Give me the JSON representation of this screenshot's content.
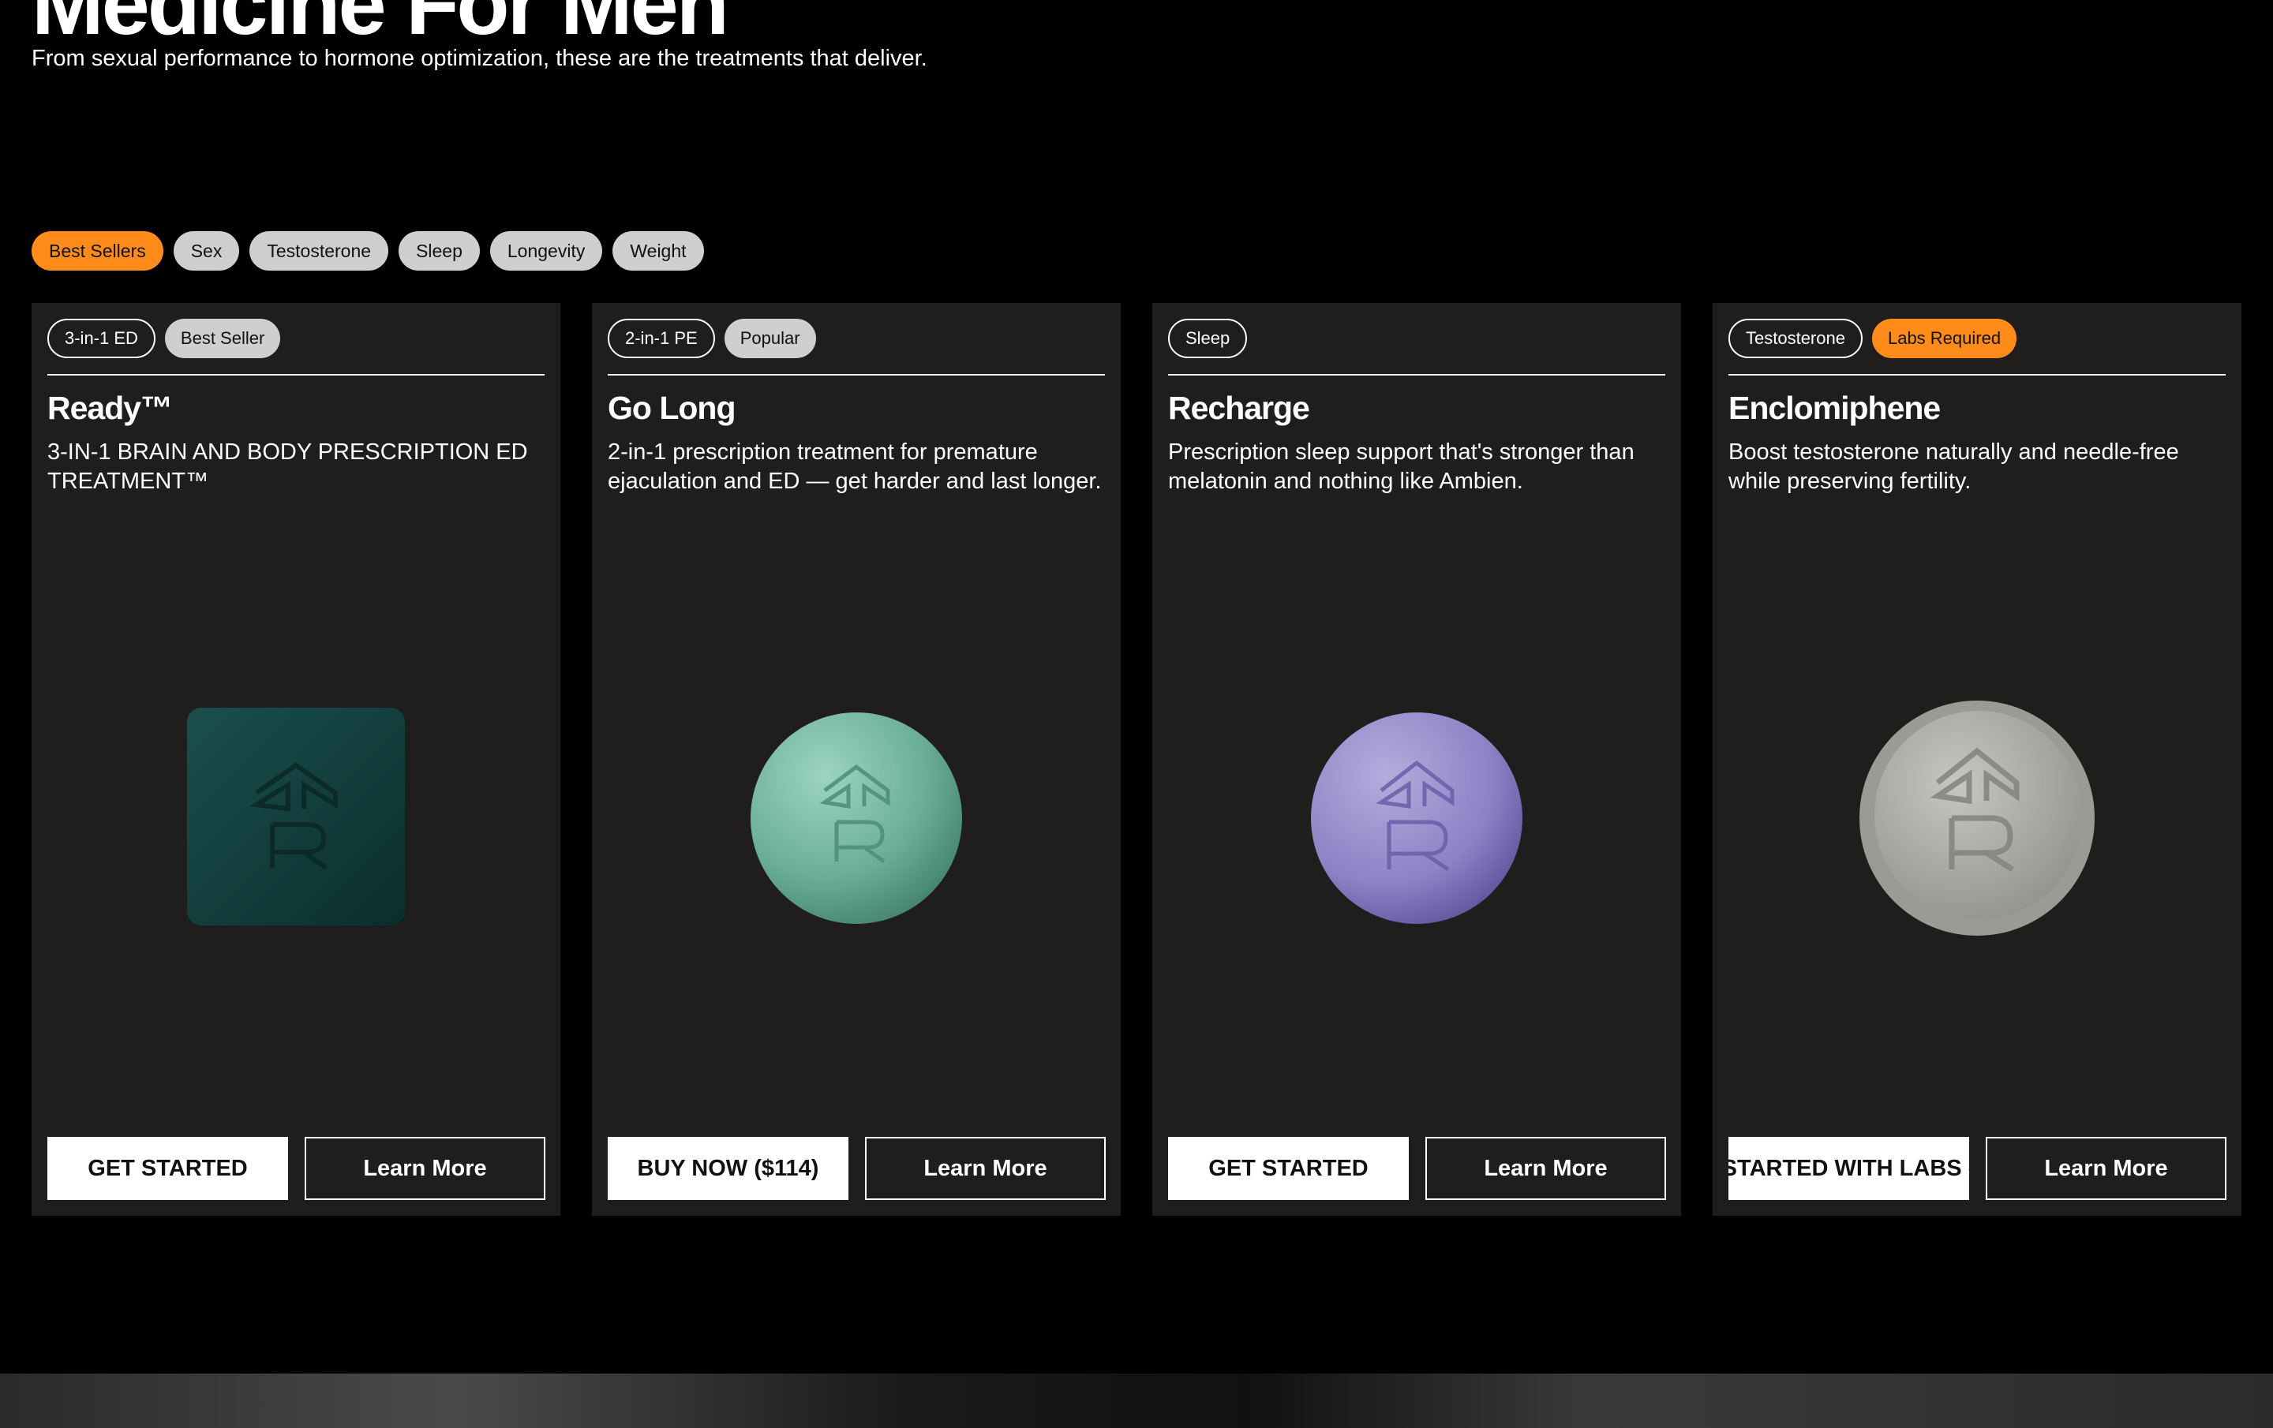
{
  "hero": {
    "title": "Medicine For Men",
    "subtitle": "From sexual performance to hormone optimization, these are the treatments that deliver."
  },
  "filters": [
    "Best Sellers",
    "Sex",
    "Testosterone",
    "Sleep",
    "Longevity",
    "Weight"
  ],
  "active_filter": "Best Sellers",
  "cards": [
    {
      "tags": [
        "3-in-1 ED",
        "Best Seller"
      ],
      "title": "Ready™",
      "description": "3-IN-1 BRAIN AND BODY PRESCRIPTION ED TREATMENT™",
      "primary_label": "GET STARTED",
      "secondary_label": "Learn More",
      "pill_color": "#0f3b3a"
    },
    {
      "tags": [
        "2-in-1 PE",
        "Popular"
      ],
      "title": "Go Long",
      "description": "2-in-1 prescription treatment for premature ejaculation and ED — get harder and last longer.",
      "primary_label": "BUY NOW ($114)",
      "secondary_label": "Learn More",
      "pill_color": "#6fb3a0"
    },
    {
      "tags": [
        "Sleep"
      ],
      "title": "Recharge",
      "description": "Prescription sleep support that's stronger than melatonin and nothing like Ambien.",
      "primary_label": "GET STARTED",
      "secondary_label": "Learn More",
      "pill_color": "#8a80c4"
    },
    {
      "tags": [
        "Testosterone",
        "Labs Required"
      ],
      "title": "Enclomiphene",
      "description": "Boost testosterone naturally and needle-free while preserving fertility.",
      "primary_label": "STARTED WITH LABS -",
      "secondary_label": "Learn More",
      "pill_color": "#b4b4b2"
    }
  ]
}
